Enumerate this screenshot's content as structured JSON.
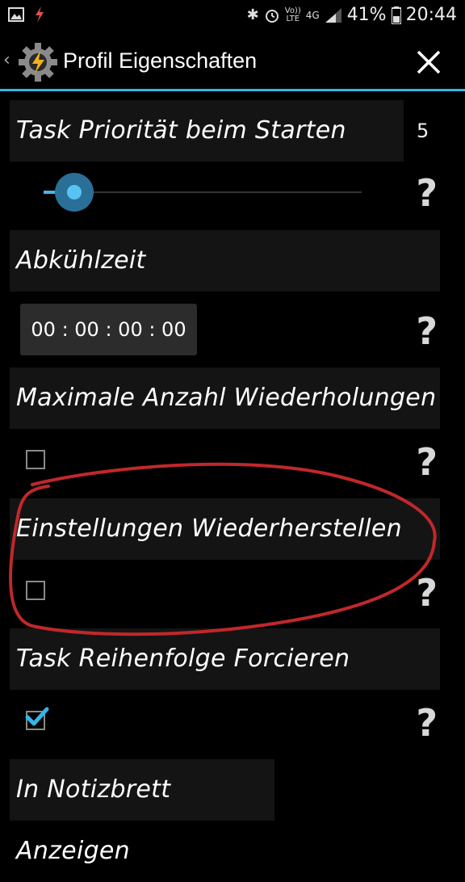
{
  "status_bar": {
    "battery_percent": "41%",
    "time": "20:44",
    "network": "4G",
    "volte_top": "Vo))",
    "volte_bottom": "LTE"
  },
  "action_bar": {
    "title": "Profil Eigenschaften"
  },
  "settings": {
    "task_priority": {
      "label": "Task Priorität beim Starten",
      "value": "5",
      "slider_fraction": 0.08
    },
    "cooldown": {
      "label": "Abkühlzeit",
      "value": "00 : 00 : 00 : 00"
    },
    "max_repeats": {
      "label": "Maximale Anzahl Wiederholungen",
      "checked": false
    },
    "restore_settings": {
      "label": "Einstellungen Wiederherstellen",
      "checked": false
    },
    "force_task_order": {
      "label": "Task Reihenfolge Forcieren",
      "checked": true
    },
    "show_in_notification": {
      "label": "In Notizbrett Anzeigen"
    }
  },
  "colors": {
    "accent": "#33b5e5",
    "annotation": "#c0282a"
  },
  "icons": [
    "image-icon",
    "flash-icon",
    "bluetooth-icon",
    "alarm-icon",
    "signal-icon",
    "battery-icon",
    "tasker-logo-icon",
    "close-icon",
    "help-icon"
  ]
}
